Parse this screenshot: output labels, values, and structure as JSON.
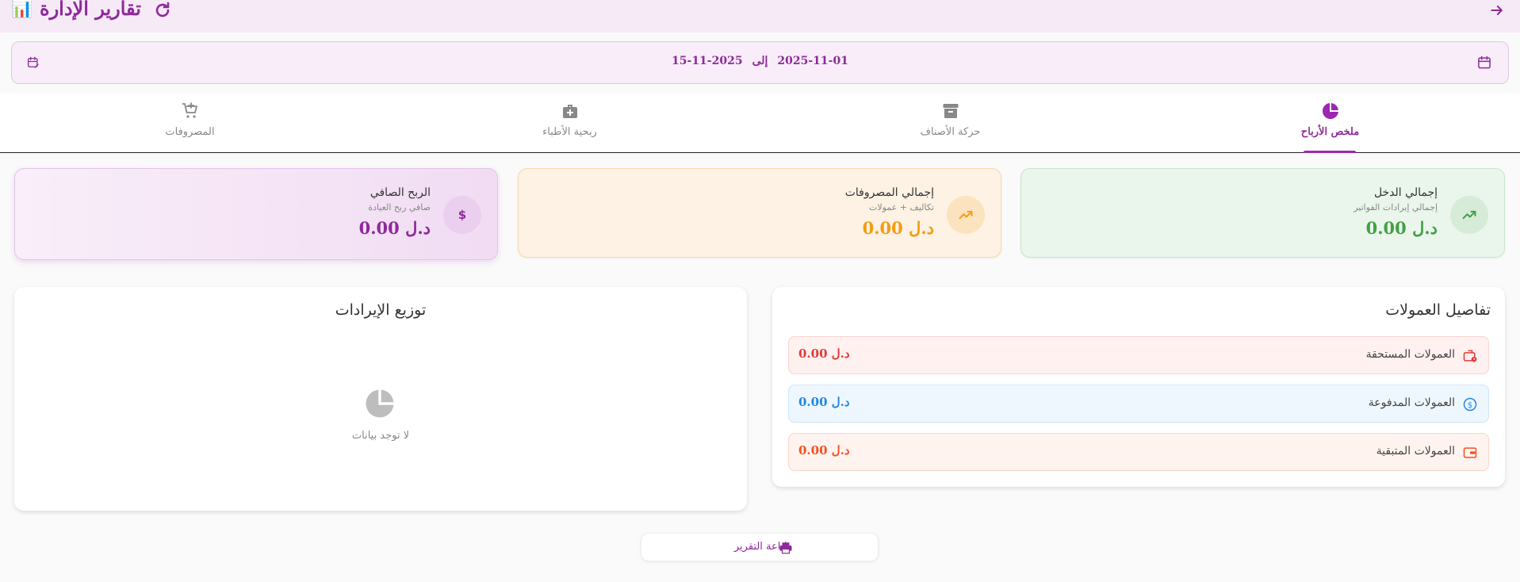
{
  "appbar": {
    "title": "تقارير الإدارة",
    "title_emoji": "📊",
    "icons": {
      "back": "arrow-right-icon",
      "refresh": "refresh-icon"
    }
  },
  "date_range": {
    "from": "2025-11-01",
    "separator": "إلى",
    "to": "2025-11-15",
    "icons": {
      "calendar": "calendar-icon",
      "edit": "calendar-edit-icon"
    }
  },
  "tabs": [
    {
      "label": "ملخص الأرباح",
      "icon": "pie-chart-icon",
      "active": true
    },
    {
      "label": "حركة الأصناف",
      "icon": "archive-icon",
      "active": false
    },
    {
      "label": "ربحية الأطباء",
      "icon": "medical-bag-icon",
      "active": false
    },
    {
      "label": "المصروفات",
      "icon": "cart-add-icon",
      "active": false
    }
  ],
  "summary_cards": {
    "income": {
      "title": "إجمالي الدخل",
      "subtitle": "إجمالي إيرادات الفواتير",
      "value": "0.00 د.ل",
      "icon": "trending-up-icon",
      "color": "#43a047"
    },
    "expenses": {
      "title": "إجمالي المصروفات",
      "subtitle": "تكاليف + عمولات",
      "value": "0.00 د.ل",
      "icon": "trending-down-icon",
      "color": "#f39c12"
    },
    "net_profit": {
      "title": "الربح الصافي",
      "subtitle": "صافي ربح العيادة",
      "value": "0.00 د.ل",
      "icon": "dollar-icon",
      "color": "#8e2a9a"
    }
  },
  "commissions": {
    "title": "تفاصيل العمولات",
    "rows": [
      {
        "label": "العمولات المستحقة",
        "value": "0.00 د.ل",
        "icon": "briefcase-clock-icon",
        "color": "#e53935"
      },
      {
        "label": "العمولات المدفوعة",
        "value": "0.00 د.ل",
        "icon": "dollar-circle-icon",
        "color": "#1e88e5"
      },
      {
        "label": "العمولات المتبقية",
        "value": "0.00 د.ل",
        "icon": "wallet-icon",
        "color": "#f4511e"
      }
    ]
  },
  "revenue_distribution": {
    "title": "توزيع الإيرادات",
    "empty_text": "لا توجد بيانات",
    "empty_icon": "pie-chart-icon"
  },
  "print_button": {
    "label": "طباعة التقرير",
    "icon": "printer-icon"
  }
}
